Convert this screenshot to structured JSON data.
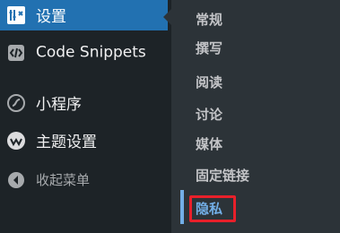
{
  "left_menu": {
    "items": [
      {
        "label": "设置",
        "icon": "settings-icon"
      },
      {
        "label": "Code Snippets",
        "icon": "code-snippets-icon"
      },
      {
        "label": "小程序",
        "icon": "mini-program-icon"
      },
      {
        "label": "主题设置",
        "icon": "theme-settings-icon"
      },
      {
        "label": "收起菜单",
        "icon": "collapse-icon"
      }
    ]
  },
  "submenu": {
    "items": [
      "常规",
      "撰写",
      "阅读",
      "讨论",
      "媒体",
      "固定链接",
      "隐私"
    ]
  },
  "colors": {
    "sidebar_bg": "#1d2327",
    "submenu_bg": "#2c3338",
    "active_blue": "#72aee6",
    "highlight_red": "#e8202a"
  }
}
